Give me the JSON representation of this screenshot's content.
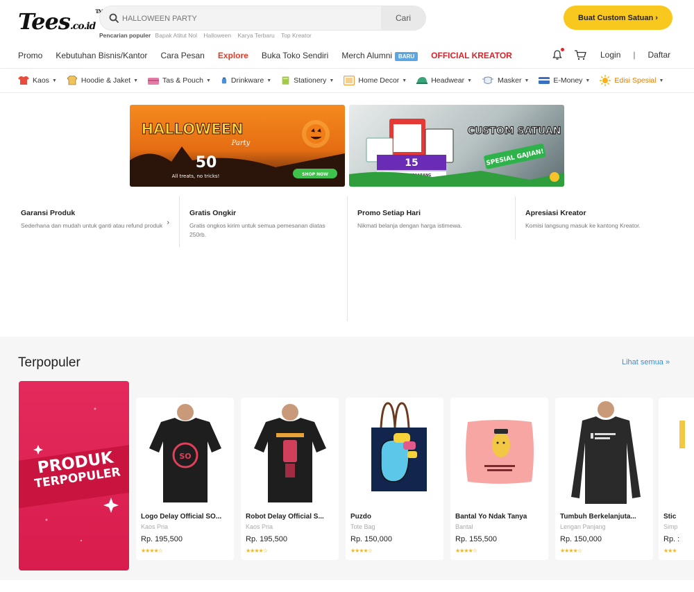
{
  "header": {
    "logo": "Tees",
    "logo_suffix": ".co.id",
    "logo_tm": "TM",
    "search_placeholder": "HALLOWEEN PARTY",
    "search_button": "Cari",
    "popular_label": "Pencarian populer",
    "popular_items": [
      "Bapak Atitut Nol",
      "Halloween",
      "Karya Terbaru",
      "Top Kreator"
    ],
    "custom_button": "Buat Custom Satuan ›"
  },
  "nav": {
    "items": [
      "Promo",
      "Kebutuhan Bisnis/Kantor",
      "Cara Pesan",
      "Explore",
      "Buka Toko Sendiri",
      "Merch Alumni",
      "OFFICIAL KREATOR"
    ],
    "badge": "BARU",
    "login": "Login",
    "separator": "|",
    "register": "Daftar"
  },
  "categories": [
    {
      "label": "Kaos",
      "icon": "tshirt-icon",
      "color": "#e84c3d"
    },
    {
      "label": "Hoodie & Jaket",
      "icon": "hoodie-icon",
      "color": "#f0c35a"
    },
    {
      "label": "Tas & Pouch",
      "icon": "bag-icon",
      "color": "#e57ca8"
    },
    {
      "label": "Drinkware",
      "icon": "bottle-icon",
      "color": "#4a90d9"
    },
    {
      "label": "Stationery",
      "icon": "notebook-icon",
      "color": "#a3c94a"
    },
    {
      "label": "Home Decor",
      "icon": "frame-icon",
      "color": "#f0a330"
    },
    {
      "label": "Headwear",
      "icon": "cap-icon",
      "color": "#39a37a"
    },
    {
      "label": "Masker",
      "icon": "mask-icon",
      "color": "#6f8ab3"
    },
    {
      "label": "E-Money",
      "icon": "card-icon",
      "color": "#3b6fc1"
    },
    {
      "label": "Edisi Spesial",
      "icon": "sun-icon",
      "color": "#f5b21a"
    }
  ],
  "banners": {
    "left": {
      "title": "HALLOWEEN",
      "subtitle": "Party",
      "discount": "50",
      "tagline": "All treats, no tricks!",
      "button": "SHOP NOW"
    },
    "right": {
      "title": "CUSTOM SATUAN",
      "badge": "SPESIAL GAJIAN!",
      "discount": "15",
      "caption": "CUSTOM SEKARANG"
    }
  },
  "benefits": [
    {
      "title": "Garansi Produk",
      "desc": "Sederhana dan mudah untuk ganti atau refund produk"
    },
    {
      "title": "Gratis Ongkir",
      "desc": "Gratis ongkos kirim untuk semua pemesanan diatas 250rb."
    },
    {
      "title": "Promo Setiap Hari",
      "desc": "Nikmati belanja dengan harga istimewa."
    },
    {
      "title": "Apresiasi Kreator",
      "desc": "Komisi langsung masuk ke kantong Kreator."
    }
  ],
  "popular": {
    "title": "Terpopuler",
    "see_all": "Lihat semua »",
    "promo_line1": "PRODUK",
    "promo_line2": "TERPOPULER",
    "products": [
      {
        "name": "Logo Delay Official SO...",
        "category": "Kaos Pria",
        "price": "Rp. 195,500",
        "rating": 4
      },
      {
        "name": "Robot Delay Official S...",
        "category": "Kaos Pria",
        "price": "Rp. 195,500",
        "rating": 4
      },
      {
        "name": "Puzdo",
        "category": "Tote Bag",
        "price": "Rp. 150,000",
        "rating": 4
      },
      {
        "name": "Bantal Yo Ndak Tanya",
        "category": "Bantal",
        "price": "Rp. 155,500",
        "rating": 4
      },
      {
        "name": "Tumbuh Berkelanjuta...",
        "category": "Lengan Panjang",
        "price": "Rp. 150,000",
        "rating": 4
      },
      {
        "name": "Stic",
        "category": "Simp",
        "price": "Rp. :",
        "rating": 4
      }
    ]
  }
}
